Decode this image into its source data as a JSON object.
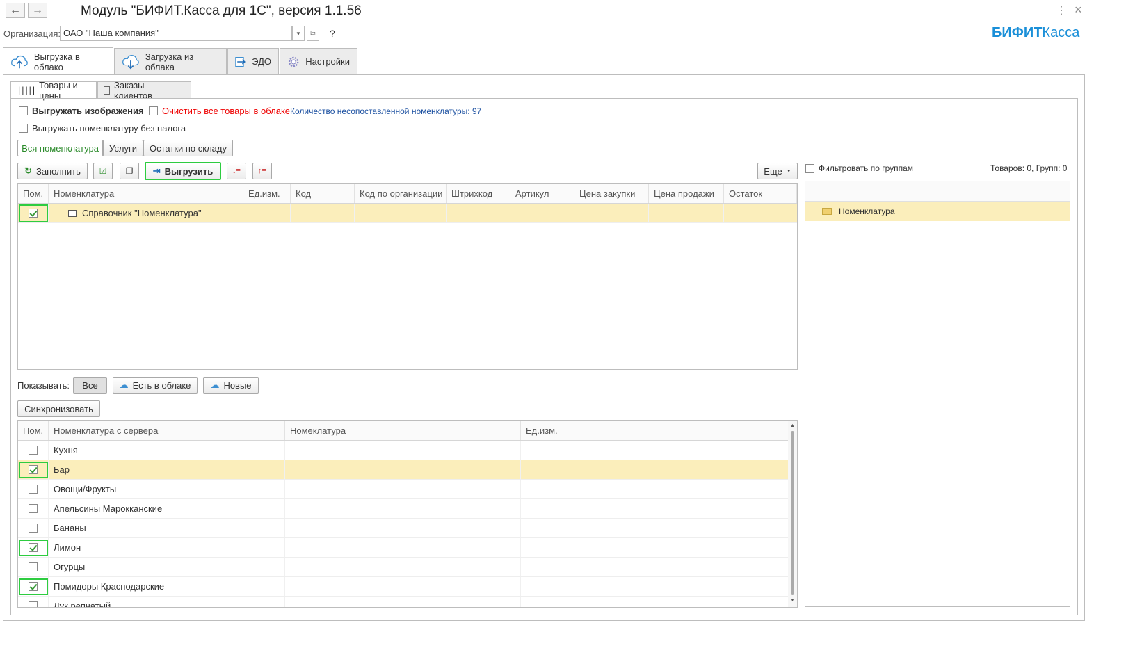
{
  "window": {
    "title": "Модуль \"БИФИТ.Касса для 1С\", версия 1.1.56",
    "back_icon": "arrow-left-icon",
    "forward_icon": "arrow-right-icon",
    "menu_icon": "vertical-dots-icon"
  },
  "org": {
    "label": "Организация:",
    "value": "ОАО \"Наша компания\"",
    "help": "?"
  },
  "brand": {
    "part1": "БИФИТ",
    "part2": "Касса",
    "color": "#1a8fd8"
  },
  "main_tabs": [
    {
      "label": "Выгрузка в облако",
      "icon": "cloud-upload-icon"
    },
    {
      "label": "Загрузка из облака",
      "icon": "cloud-download-icon"
    },
    {
      "label": "ЭДО",
      "icon": "edo-arrow-icon"
    },
    {
      "label": "Настройки",
      "icon": "gear-icon"
    }
  ],
  "sub_tabs": [
    {
      "label": "Товары и цены",
      "icon": "barcode-icon"
    },
    {
      "label": "Заказы клиентов",
      "icon": "document-icon"
    }
  ],
  "options": {
    "export_images": "Выгружать изображения",
    "clear_cloud": "Очистить все товары в облаке",
    "unmatched_link": "Количество несопоставленной номенклатуры: 97",
    "export_no_tax": "Выгружать номенклатуру без налога"
  },
  "filter_tabs": [
    "Вся номенклатура",
    "Услуги",
    "Остатки по складу"
  ],
  "toolbar": {
    "fill": "Заполнить",
    "upload": "Выгрузить",
    "more": "Еще"
  },
  "top_grid": {
    "columns": [
      "Пом.",
      "Номенклатура",
      "Ед.изм.",
      "Код",
      "Код по организации",
      "Штрихкод",
      "Артикул",
      "Цена закупки",
      "Цена продажи",
      "Остаток"
    ],
    "rows": [
      {
        "checked": true,
        "name": "Справочник \"Номенклатура\""
      }
    ]
  },
  "right_panel": {
    "filter_label": "Фильтровать по группам",
    "counts": "Товаров: 0, Групп: 0",
    "tree_item": "Номенклатура"
  },
  "show": {
    "label": "Показывать:",
    "all": "Все",
    "in_cloud": "Есть в облаке",
    "new": "Новые"
  },
  "sync_button": "Синхронизовать",
  "bottom_grid": {
    "columns": [
      "Пом.",
      "Номенклатура с сервера",
      "Номеклатура",
      "Ед.изм."
    ],
    "rows": [
      {
        "checked": false,
        "name": "Кухня"
      },
      {
        "checked": true,
        "name": "Бар"
      },
      {
        "checked": false,
        "name": "Овощи/Фрукты"
      },
      {
        "checked": false,
        "name": "Апельсины Марокканские"
      },
      {
        "checked": false,
        "name": "Бананы"
      },
      {
        "checked": true,
        "name": "Лимон"
      },
      {
        "checked": false,
        "name": "Огурцы"
      },
      {
        "checked": true,
        "name": "Помидоры Краснодарские"
      },
      {
        "checked": false,
        "name": "Лук репчатый"
      }
    ]
  }
}
